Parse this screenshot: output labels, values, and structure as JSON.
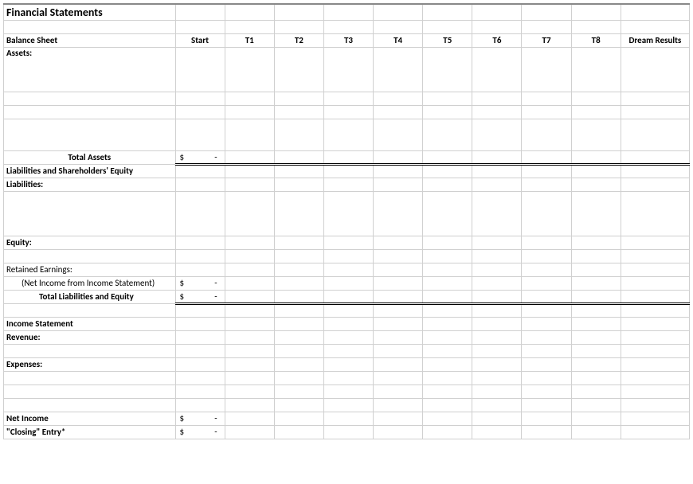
{
  "title": "Financial Statements",
  "headers": {
    "label": "Balance Sheet",
    "cols": [
      "Start",
      "T1",
      "T2",
      "T3",
      "T4",
      "T5",
      "T6",
      "T7",
      "T8",
      "Dream Results"
    ]
  },
  "rows": {
    "assets": "Assets:",
    "total_assets": "Total Assets",
    "total_assets_val_sym": "$",
    "total_assets_val_num": "-",
    "liab_eq": "Liabilities and Shareholders' Equity",
    "liabilities": "Liabilities:",
    "equity": "Equity:",
    "retained": "Retained Earnings:",
    "net_income_from": "(Net Income from Income Statement)",
    "nifi_sym": "$",
    "nifi_num": "-",
    "total_liab_eq": "Total Liabilities and Equity",
    "total_liab_eq_sym": "$",
    "total_liab_eq_num": "-",
    "income_stmt": "Income Statement",
    "revenue": "Revenue:",
    "expenses": "Expenses:",
    "net_income": "Net Income",
    "net_income_sym": "$",
    "net_income_num": "-",
    "closing": "\"Closing\" Entry*",
    "closing_sym": "$",
    "closing_num": "-"
  }
}
